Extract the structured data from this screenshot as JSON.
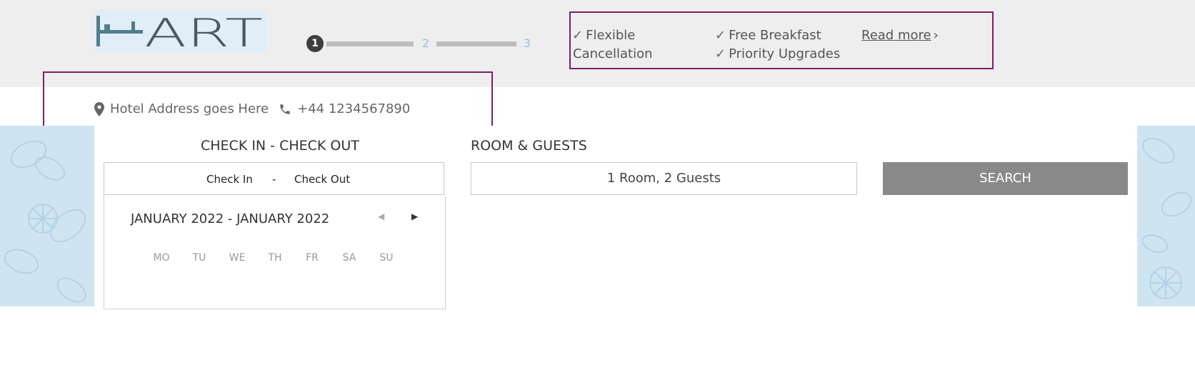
{
  "logo": {
    "text": "HART"
  },
  "steps": {
    "items": [
      "1",
      "2",
      "3"
    ],
    "active_index": 0
  },
  "benefits": {
    "items": [
      {
        "check": "✓",
        "text": "Flexible"
      },
      {
        "text": "Cancellation"
      },
      {
        "check": "✓",
        "text": "Free Breakfast"
      },
      {
        "check": "✓",
        "text": "Priority Upgrades"
      }
    ],
    "read_more": "Read more",
    "chevron": "›"
  },
  "contact": {
    "address": "Hotel Address goes Here",
    "phone": "+44 1234567890"
  },
  "booking": {
    "dates_label": "CHECK IN - CHECK OUT",
    "check_in": "Check In",
    "separator": "-",
    "check_out": "Check Out",
    "guests_label": "ROOM & GUESTS",
    "guests_value": "1 Room, 2 Guests",
    "search": "SEARCH"
  },
  "calendar": {
    "title": "JANUARY 2022 - JANUARY 2022",
    "prev": "◀",
    "next": "▶",
    "days": [
      "MO",
      "TU",
      "WE",
      "TH",
      "FR",
      "SA",
      "SU"
    ]
  },
  "colors": {
    "accent_border": "#7b1f6a",
    "search_bg": "#888988",
    "header_bg": "#eeeeee",
    "deco_bg": "#cfe4f1"
  }
}
